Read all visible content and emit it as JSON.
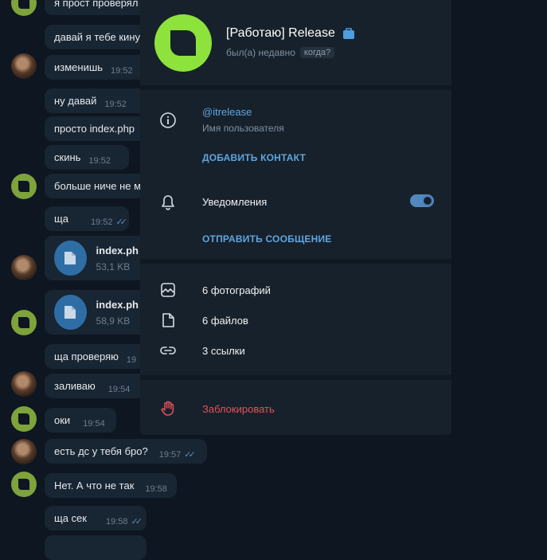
{
  "chat": {
    "messages": [
      {
        "text": "я прост проверял",
        "time": ""
      },
      {
        "text": "давай я тебе кину",
        "time": ""
      },
      {
        "text": "изменишь",
        "time": "19:52"
      },
      {
        "text": "ну давай",
        "time": "19:52"
      },
      {
        "text": "просто index.php",
        "time": ""
      },
      {
        "text": "скинь",
        "time": "19:52"
      },
      {
        "text": "больше ниче не м",
        "time": ""
      },
      {
        "text": "ща",
        "time": "19:52"
      },
      {
        "text": "ща проверяю",
        "time": "19"
      },
      {
        "text": "заливаю",
        "time": "19:54"
      },
      {
        "text": "оки",
        "time": "19:54"
      },
      {
        "text": "есть дс у тебя бро?",
        "time": "19:57"
      },
      {
        "text": "Нет. А что не так",
        "time": "19:58"
      },
      {
        "text": "ща сек",
        "time": "19:58"
      }
    ],
    "files": [
      {
        "name": "index.ph",
        "size": "53,1 KB"
      },
      {
        "name": "index.ph",
        "size": "58,9 KB"
      }
    ]
  },
  "profile": {
    "name": "[Работаю] Release",
    "status": "был(а) недавно",
    "status_when": "когда?",
    "username": "@itrelease",
    "username_label": "Имя пользователя",
    "add_contact": "ДОБАВИТЬ КОНТАКТ",
    "notifications": "Уведомления",
    "notifications_on": true,
    "send_message": "ОТПРАВИТЬ СООБЩЕНИЕ",
    "photos": "6 фотографий",
    "files": "6 файлов",
    "links": "3 ссылки",
    "block": "Заблокировать"
  },
  "colors": {
    "accent": "#5ea6e0",
    "danger": "#e5505a",
    "avatar_green": "#8ee23c",
    "panel_bg": "#17212b",
    "chat_bg": "#0e1621"
  }
}
